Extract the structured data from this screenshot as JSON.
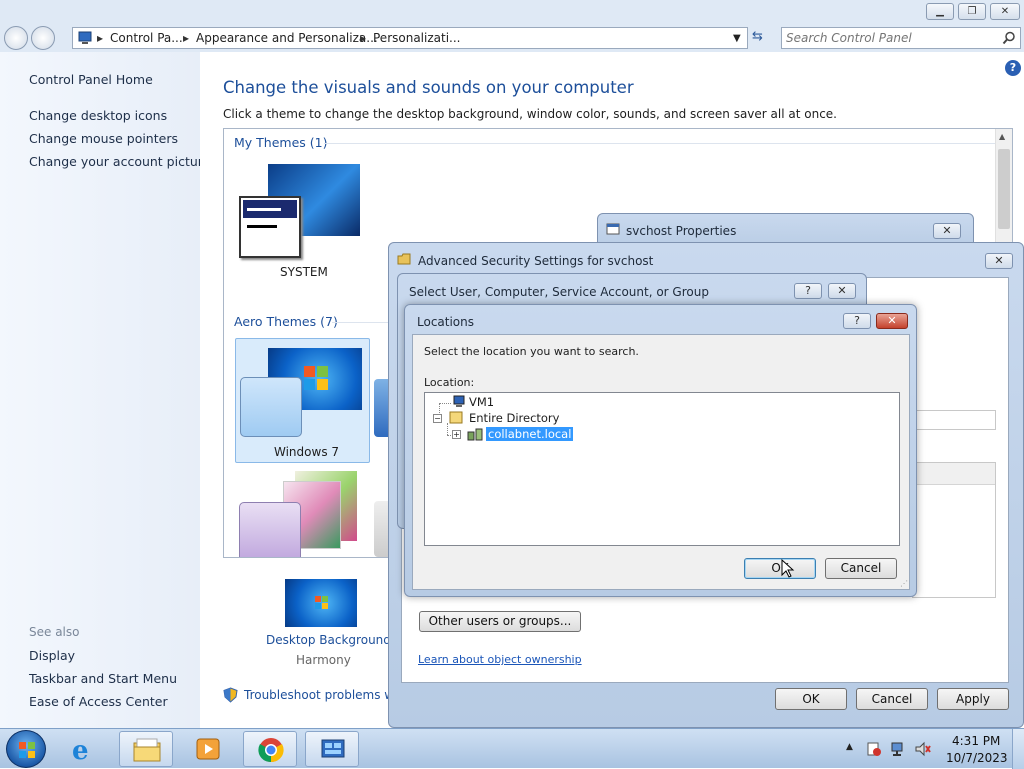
{
  "window": {
    "breadcrumb": [
      "Control Pa...",
      "Appearance and Personaliza...",
      "Personalizati..."
    ],
    "search_placeholder": "Search Control Panel",
    "caption": {
      "minimize": "▁",
      "maximize": "❐",
      "close": "✕"
    }
  },
  "sidebar": {
    "home": "Control Panel Home",
    "links": [
      "Change desktop icons",
      "Change mouse pointers",
      "Change your account picture"
    ],
    "see_also_label": "See also",
    "see_also": [
      "Display",
      "Taskbar and Start Menu",
      "Ease of Access Center"
    ]
  },
  "main": {
    "heading": "Change the visuals and sounds on your computer",
    "subheading": "Click a theme to change the desktop background, window color, sounds, and screen saver all at once.",
    "my_themes_header": "My Themes (1)",
    "my_theme_name": "SYSTEM",
    "aero_header": "Aero Themes (7)",
    "aero_theme_name": "Windows 7",
    "desktop_background_label": "Desktop Background",
    "desktop_background_value": "Harmony",
    "troubleshoot": "Troubleshoot problems wit"
  },
  "props_dialog": {
    "title": "svchost Properties"
  },
  "adv_security": {
    "title": "Advanced Security Settings for svchost",
    "other_users_button": "Other users or groups...",
    "learn_link": "Learn about object ownership",
    "ok": "OK",
    "cancel": "Cancel",
    "apply": "Apply"
  },
  "select_user": {
    "title": "Select User, Computer, Service Account, or Group"
  },
  "locations": {
    "title": "Locations",
    "instruction": "Select the location you want to search.",
    "location_label": "Location:",
    "tree": [
      {
        "label": "VM1",
        "icon": "computer-icon",
        "selected": false
      },
      {
        "label": "Entire Directory",
        "icon": "directory-icon",
        "selected": false
      },
      {
        "label": "collabnet.local",
        "icon": "domain-icon",
        "selected": true
      }
    ],
    "ok": "OK",
    "cancel": "Cancel"
  },
  "taskbar": {
    "clock_time": "4:31 PM",
    "clock_date": "10/7/2023",
    "apps": [
      "internet-explorer-icon",
      "file-explorer-icon",
      "media-player-icon",
      "chrome-icon",
      "control-panel-icon"
    ]
  }
}
